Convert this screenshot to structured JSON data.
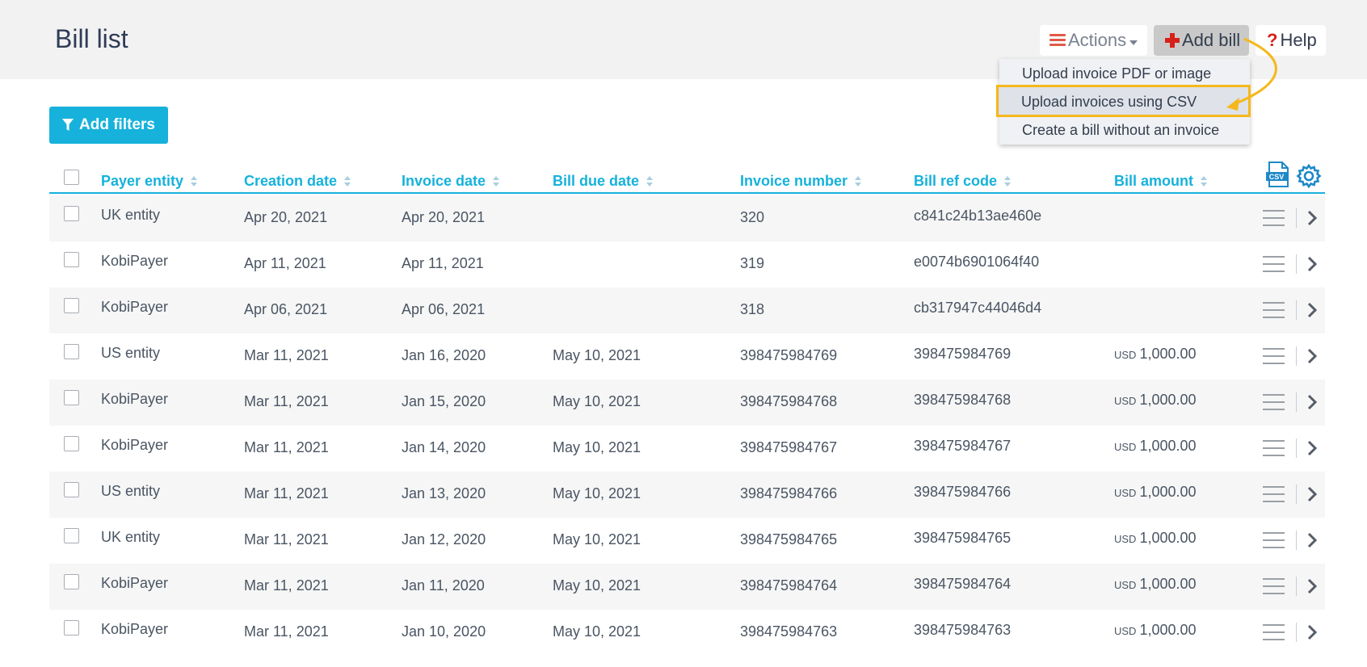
{
  "header": {
    "title": "Bill list",
    "actions_label": "Actions",
    "add_bill_label": "Add bill",
    "help_label": "Help"
  },
  "dropdown": {
    "items": [
      {
        "label": "Upload invoice PDF or image"
      },
      {
        "label": "Upload invoices using CSV"
      },
      {
        "label": "Create a bill without an invoice"
      }
    ]
  },
  "filters": {
    "add_filters_label": "Add filters"
  },
  "table": {
    "columns": [
      {
        "label": "Payer entity"
      },
      {
        "label": "Creation date"
      },
      {
        "label": "Invoice date"
      },
      {
        "label": "Bill due date"
      },
      {
        "label": "Invoice number"
      },
      {
        "label": "Bill ref code"
      },
      {
        "label": "Bill amount"
      }
    ],
    "rows": [
      {
        "payer": "UK entity",
        "created": "Apr 20, 2021",
        "invoice_date": "Apr 20, 2021",
        "due": "",
        "invoice_no": "320",
        "ref": "c841c24b13ae460e",
        "currency": "",
        "amount": ""
      },
      {
        "payer": "KobiPayer",
        "created": "Apr 11, 2021",
        "invoice_date": "Apr 11, 2021",
        "due": "",
        "invoice_no": "319",
        "ref": "e0074b6901064f40",
        "currency": "",
        "amount": ""
      },
      {
        "payer": "KobiPayer",
        "created": "Apr 06, 2021",
        "invoice_date": "Apr 06, 2021",
        "due": "",
        "invoice_no": "318",
        "ref": "cb317947c44046d4",
        "currency": "",
        "amount": ""
      },
      {
        "payer": "US entity",
        "created": "Mar 11, 2021",
        "invoice_date": "Jan 16, 2020",
        "due": "May 10, 2021",
        "invoice_no": "398475984769",
        "ref": "398475984769",
        "currency": "USD",
        "amount": "1,000.00"
      },
      {
        "payer": "KobiPayer",
        "created": "Mar 11, 2021",
        "invoice_date": "Jan 15, 2020",
        "due": "May 10, 2021",
        "invoice_no": "398475984768",
        "ref": "398475984768",
        "currency": "USD",
        "amount": "1,000.00"
      },
      {
        "payer": "KobiPayer",
        "created": "Mar 11, 2021",
        "invoice_date": "Jan 14, 2020",
        "due": "May 10, 2021",
        "invoice_no": "398475984767",
        "ref": "398475984767",
        "currency": "USD",
        "amount": "1,000.00"
      },
      {
        "payer": "US entity",
        "created": "Mar 11, 2021",
        "invoice_date": "Jan 13, 2020",
        "due": "May 10, 2021",
        "invoice_no": "398475984766",
        "ref": "398475984766",
        "currency": "USD",
        "amount": "1,000.00"
      },
      {
        "payer": "UK entity",
        "created": "Mar 11, 2021",
        "invoice_date": "Jan 12, 2020",
        "due": "May 10, 2021",
        "invoice_no": "398475984765",
        "ref": "398475984765",
        "currency": "USD",
        "amount": "1,000.00"
      },
      {
        "payer": "KobiPayer",
        "created": "Mar 11, 2021",
        "invoice_date": "Jan 11, 2020",
        "due": "May 10, 2021",
        "invoice_no": "398475984764",
        "ref": "398475984764",
        "currency": "USD",
        "amount": "1,000.00"
      },
      {
        "payer": "KobiPayer",
        "created": "Mar 11, 2021",
        "invoice_date": "Jan 10, 2020",
        "due": "May 10, 2021",
        "invoice_no": "398475984763",
        "ref": "398475984763",
        "currency": "USD",
        "amount": "1,000.00"
      }
    ]
  },
  "icons": {
    "csv_badge": "CSV",
    "highlight_color": "#f5b81c",
    "accent_color": "#16b2db"
  }
}
